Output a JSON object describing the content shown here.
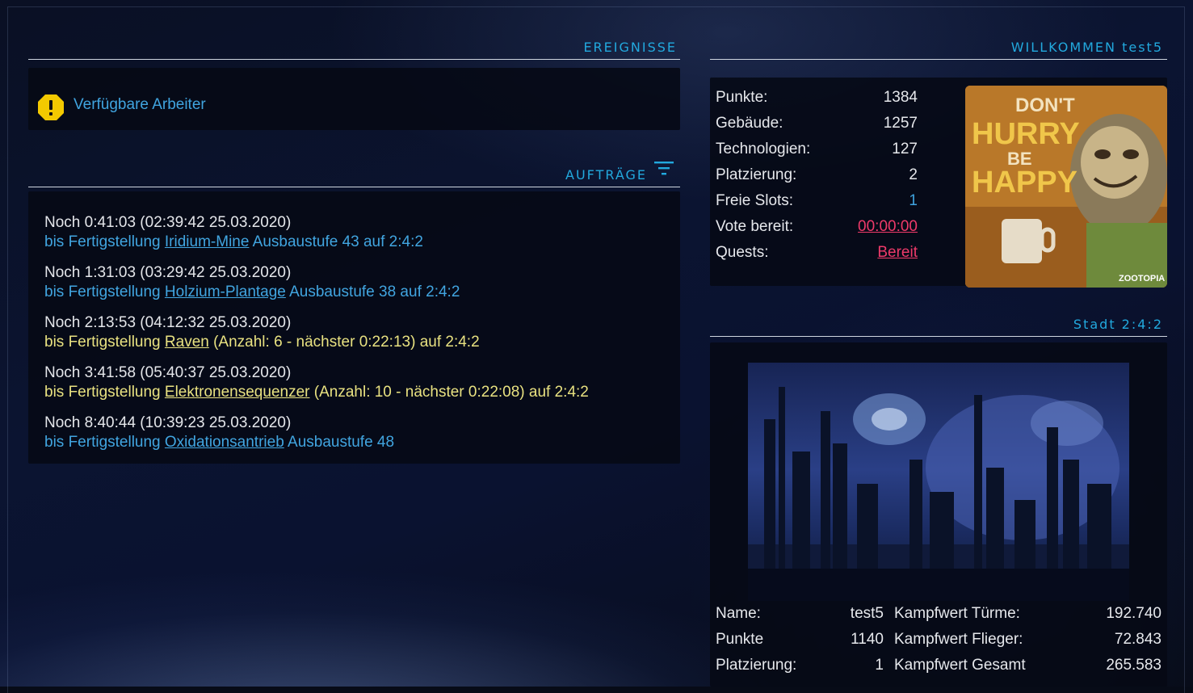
{
  "events": {
    "title": "EREIGNISSE",
    "items": [
      {
        "icon": "warning-icon",
        "label": "Verfügbare Arbeiter"
      }
    ]
  },
  "orders": {
    "title": "AUFTRÄGE",
    "filter_icon": "filter-icon",
    "items": [
      {
        "when": "Noch 0:41:03 (02:39:42 25.03.2020)",
        "prefix": "bis Fertigstellung",
        "link": "Iridium-Mine",
        "suffix": "Ausbaustufe 43 auf 2:4:2"
      },
      {
        "when": "Noch 1:31:03 (03:29:42 25.03.2020)",
        "prefix": "bis Fertigstellung",
        "link": "Holzium-Plantage",
        "suffix": "Ausbaustufe 38 auf 2:4:2"
      },
      {
        "when": "Noch 2:13:53 (04:12:32 25.03.2020)",
        "prefix": "bis Fertigstellung",
        "link": "Raven",
        "suffix": "(Anzahl: 6 - nächster 0:22:13) auf 2:4:2"
      },
      {
        "when": "Noch 3:41:58 (05:40:37 25.03.2020)",
        "prefix": "bis Fertigstellung",
        "link": "Elektronensequenzer",
        "suffix": "(Anzahl: 10 - nächster 0:22:08) auf 2:4:2"
      },
      {
        "when": "Noch 8:40:44 (10:39:23 25.03.2020)",
        "prefix": "bis Fertigstellung",
        "link": "Oxidationsantrieb",
        "suffix": "Ausbaustufe 48"
      }
    ]
  },
  "welcome": {
    "title": "WILLKOMMEN test5",
    "stats": [
      {
        "label": "Punkte:",
        "value": "1384"
      },
      {
        "label": "Gebäude:",
        "value": "1257"
      },
      {
        "label": "Technologien:",
        "value": "127"
      },
      {
        "label": "Platzierung:",
        "value": "2"
      },
      {
        "label": "Freie Slots:",
        "value": "1"
      },
      {
        "label": "Vote bereit:",
        "value": "00:00:00"
      },
      {
        "label": "Quests:",
        "value": "Bereit"
      }
    ],
    "avatar": {
      "line1": "DON'T",
      "line2": "HURRY",
      "line3": "BE",
      "line4": "HAPPY",
      "brand": "ZOOTOPIA"
    }
  },
  "city": {
    "title": "Stadt 2:4:2",
    "left": [
      {
        "label": "Name:",
        "value": "test5"
      },
      {
        "label": "Punkte",
        "value": "1140"
      },
      {
        "label": "Platzierung:",
        "value": "1"
      }
    ],
    "right": [
      {
        "label": "Kampfwert Türme:",
        "value": "192.740"
      },
      {
        "label": "Kampfwert Flieger:",
        "value": "72.843"
      },
      {
        "label": "Kampfwert Gesamt",
        "value": "265.583"
      }
    ]
  },
  "colors": {
    "accent": "#22a9de",
    "link_blue": "#41a5e0",
    "link_yellow": "#e9e281",
    "alert_red": "#ef3a6a",
    "warning_yellow": "#f3c900"
  }
}
